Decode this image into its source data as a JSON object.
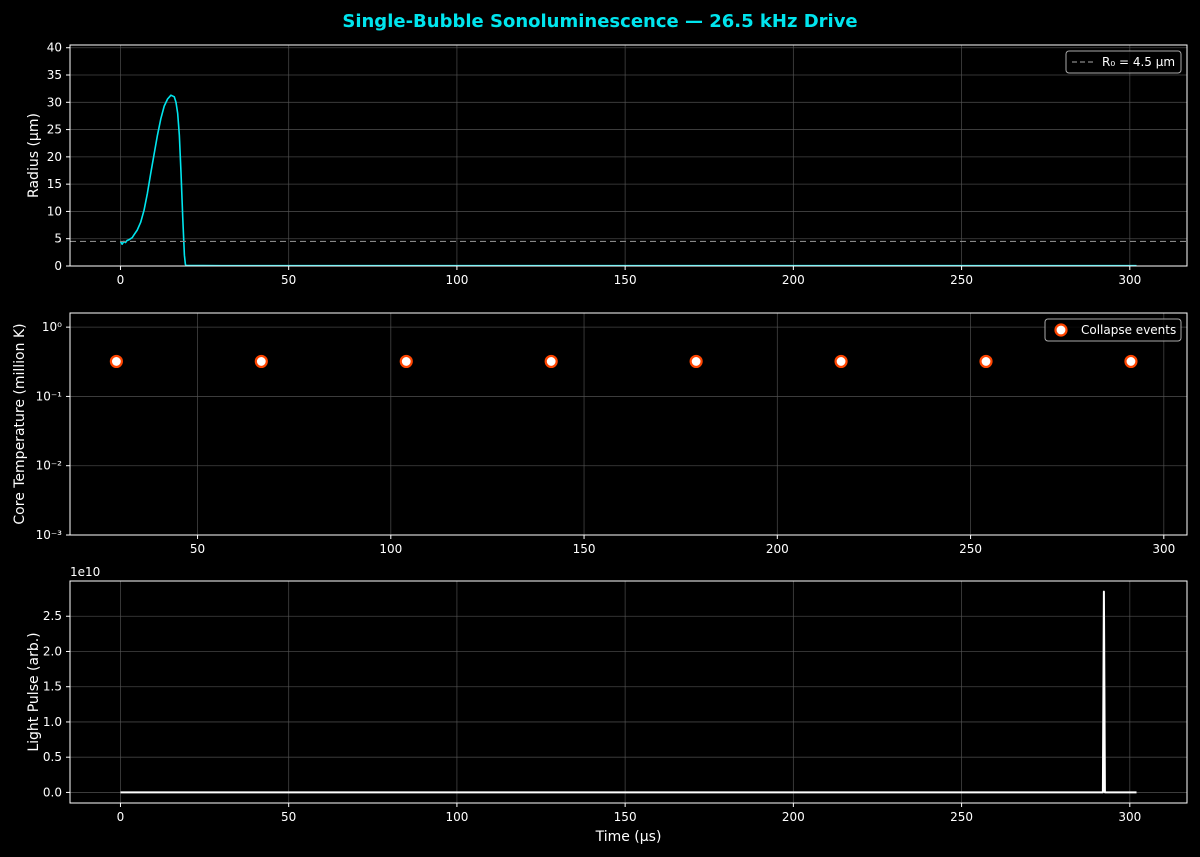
{
  "figure": {
    "title": "Single-Bubble Sonoluminescence — 26.5 kHz Drive",
    "background": "#000000",
    "title_color": "#00e5ee",
    "text_color": "#ffffff",
    "grid_color": "#555555"
  },
  "chart_data": [
    {
      "type": "line",
      "ylabel": "Radius (μm)",
      "xlabel": "",
      "xlim": [
        -15,
        317
      ],
      "ylim": [
        0,
        40.5
      ],
      "xticks": [
        0,
        50,
        100,
        150,
        200,
        250,
        300
      ],
      "yticks": [
        0,
        5,
        10,
        15,
        20,
        25,
        30,
        35,
        40
      ],
      "grid": true,
      "legend": {
        "position": "top-right",
        "entries": [
          "R₀ = 4.5 μm"
        ]
      },
      "series": [
        {
          "name": "",
          "color": "#00e5ee",
          "x": [
            0,
            0.5,
            1,
            1.5,
            2,
            2.5,
            3,
            3.5,
            4,
            5,
            6,
            7,
            8,
            9,
            10,
            11,
            12,
            13,
            14,
            15,
            16,
            16.5,
            17,
            17.5,
            18,
            18.5,
            19,
            19.3,
            19.5,
            30,
            60,
            100,
            150,
            200,
            250,
            302
          ],
          "y": [
            4.5,
            4.0,
            4.5,
            4.3,
            4.7,
            4.8,
            5.0,
            5.2,
            5.7,
            6.6,
            8.0,
            10.2,
            13.3,
            17.0,
            20.5,
            24.0,
            27.0,
            29.3,
            30.6,
            31.3,
            31.0,
            30.0,
            28.0,
            24.0,
            17.0,
            9.0,
            2.0,
            0.3,
            0.1,
            0.05,
            0.05,
            0.05,
            0.05,
            0.05,
            0.05,
            0.05
          ]
        },
        {
          "name": "R₀ = 4.5 μm",
          "color": "#888888",
          "style": "dashed",
          "constant_y": 4.5
        }
      ]
    },
    {
      "type": "scatter",
      "ylabel": "Core Temperature (million K)",
      "xlabel": "",
      "xlim": [
        17,
        306
      ],
      "ylim": [
        0.001,
        1.6
      ],
      "yscale": "log",
      "xticks": [
        50,
        100,
        150,
        200,
        250,
        300
      ],
      "yticks": [
        0.001,
        0.01,
        0.1,
        1
      ],
      "ytick_labels": [
        "10⁻³",
        "10⁻²",
        "10⁻¹",
        "10⁰"
      ],
      "grid": true,
      "legend": {
        "position": "top-right",
        "entries": [
          "Collapse events"
        ]
      },
      "series": [
        {
          "name": "Collapse events",
          "marker_fill": "#ffffff",
          "marker_edge": "#ff4500",
          "x": [
            29,
            66.5,
            104,
            141.5,
            179,
            216.5,
            254,
            291.5
          ],
          "y": [
            0.32,
            0.32,
            0.32,
            0.32,
            0.32,
            0.32,
            0.32,
            0.32
          ]
        }
      ]
    },
    {
      "type": "line",
      "ylabel": "Light Pulse (arb.)",
      "xlabel": "Time (μs)",
      "xlim": [
        -15,
        317
      ],
      "ylim": [
        -1.5,
        30.0
      ],
      "offset_label": "1e10",
      "xticks": [
        0,
        50,
        100,
        150,
        200,
        250,
        300
      ],
      "yticks": [
        0,
        5,
        10,
        15,
        20,
        25
      ],
      "ytick_labels": [
        "0.0",
        "0.5",
        "1.0",
        "1.5",
        "2.0",
        "2.5"
      ],
      "grid": true,
      "series": [
        {
          "name": "",
          "color": "#ffffff",
          "x": [
            0,
            292,
            292.3,
            292.6,
            302
          ],
          "y": [
            0,
            0,
            28.5,
            0,
            0
          ]
        }
      ]
    }
  ]
}
